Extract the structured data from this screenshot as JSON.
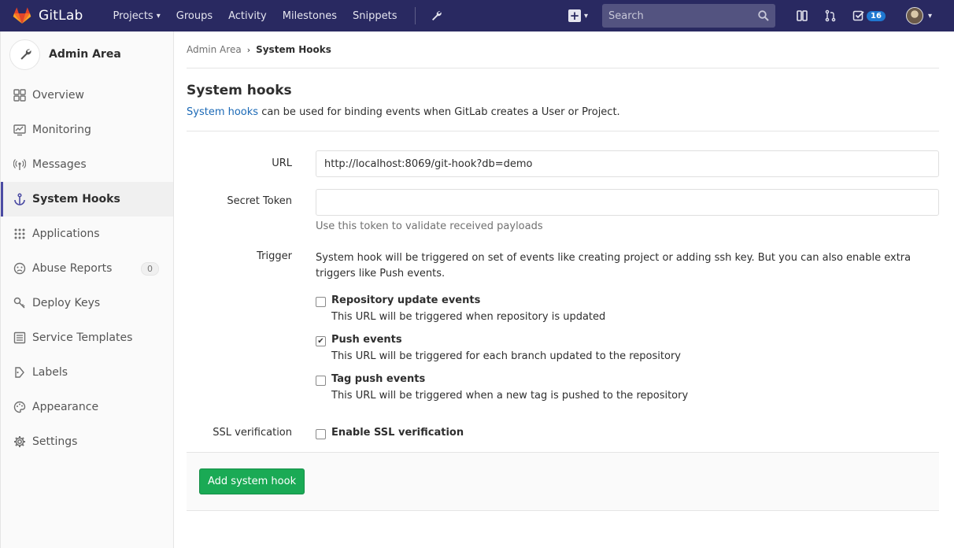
{
  "navbar": {
    "brand": "GitLab",
    "links": [
      {
        "label": "Projects",
        "has_caret": true
      },
      {
        "label": "Groups"
      },
      {
        "label": "Activity"
      },
      {
        "label": "Milestones"
      },
      {
        "label": "Snippets"
      }
    ],
    "search_placeholder": "Search",
    "todo_count": "16",
    "brand_color": "#292961"
  },
  "sidebar": {
    "title": "Admin Area",
    "items": [
      {
        "label": "Overview",
        "icon": "grid-icon"
      },
      {
        "label": "Monitoring",
        "icon": "monitor-icon"
      },
      {
        "label": "Messages",
        "icon": "broadcast-icon"
      },
      {
        "label": "System Hooks",
        "icon": "anchor-icon",
        "active": true
      },
      {
        "label": "Applications",
        "icon": "apps-icon"
      },
      {
        "label": "Abuse Reports",
        "icon": "abuse-icon",
        "badge": "0"
      },
      {
        "label": "Deploy Keys",
        "icon": "key-icon"
      },
      {
        "label": "Service Templates",
        "icon": "template-icon"
      },
      {
        "label": "Labels",
        "icon": "label-icon"
      },
      {
        "label": "Appearance",
        "icon": "palette-icon"
      },
      {
        "label": "Settings",
        "icon": "gear-icon"
      }
    ]
  },
  "breadcrumb": {
    "parent": "Admin Area",
    "current": "System Hooks"
  },
  "page": {
    "title": "System hooks",
    "desc_link": "System hooks",
    "desc_rest": " can be used for binding events when GitLab creates a User or Project."
  },
  "form": {
    "url_label": "URL",
    "url_value": "http://localhost:8069/git-hook?db=demo",
    "token_label": "Secret Token",
    "token_value": "",
    "token_help": "Use this token to validate received payloads",
    "trigger_label": "Trigger",
    "trigger_text": "System hook will be triggered on set of events like creating project or adding ssh key. But you can also enable extra triggers like Push events.",
    "triggers": [
      {
        "title": "Repository update events",
        "desc": "This URL will be triggered when repository is updated",
        "checked": false
      },
      {
        "title": "Push events",
        "desc": "This URL will be triggered for each branch updated to the repository",
        "checked": true
      },
      {
        "title": "Tag push events",
        "desc": "This URL will be triggered when a new tag is pushed to the repository",
        "checked": false
      }
    ],
    "ssl_label": "SSL verification",
    "ssl_title": "Enable SSL verification",
    "ssl_checked": false,
    "submit_label": "Add system hook"
  }
}
